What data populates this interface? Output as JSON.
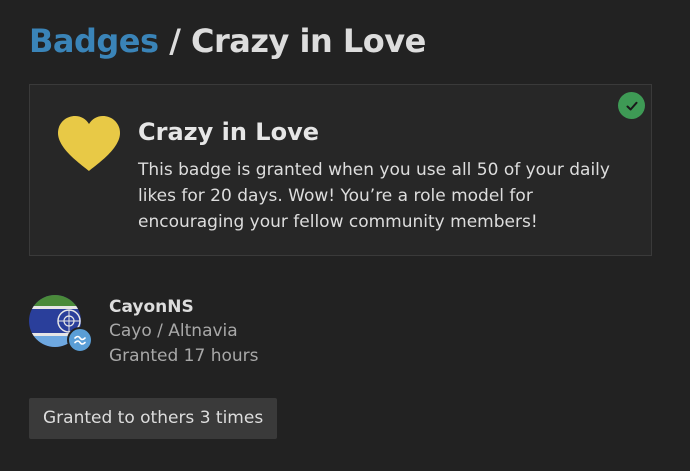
{
  "breadcrumb": {
    "parent_label": "Badges",
    "separator": "/",
    "current_label": "Crazy in Love"
  },
  "badge": {
    "name": "Crazy in Love",
    "description": "This badge is granted when you use all 50 of your daily likes for 20 days. Wow! You’re a role model for encouraging your fellow community members!",
    "icon": "heart-icon",
    "icon_color": "#e8c946",
    "granted_indicator_icon": "check-icon",
    "granted_indicator_color": "#3e9a55"
  },
  "grant": {
    "username": "CayonNS",
    "user_title": "Cayo / Altnavia",
    "granted_time": "Granted 17 hours"
  },
  "others_button_label": "Granted to others 3 times",
  "colors": {
    "link": "#3a84b8",
    "background": "#222222",
    "card_background": "#272727"
  }
}
